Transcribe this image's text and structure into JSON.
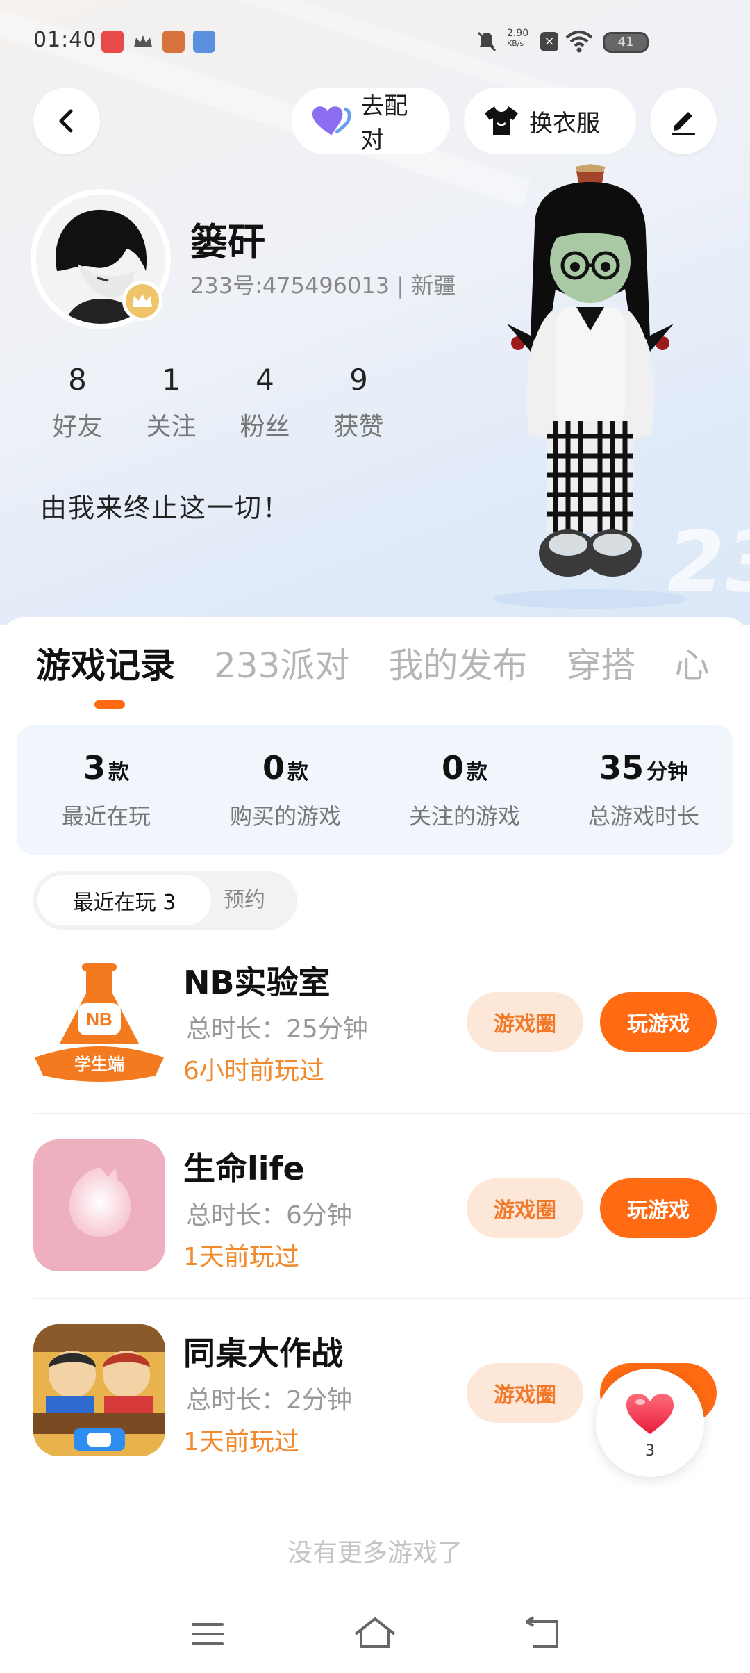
{
  "status_bar": {
    "time": "01:40",
    "net_speed": "2.90",
    "net_unit": "KB/s",
    "battery": "41"
  },
  "header": {
    "pair_label": "去配对",
    "dress_label": "换衣服"
  },
  "profile": {
    "nickname": "篓矸",
    "uid": "233号:475496013 | 新疆",
    "stats": [
      {
        "value": "8",
        "label": "好友"
      },
      {
        "value": "1",
        "label": "关注"
      },
      {
        "value": "4",
        "label": "粉丝"
      },
      {
        "value": "9",
        "label": "获赞"
      }
    ],
    "bio": "由我来终止这一切！"
  },
  "tabs": [
    "游戏记录",
    "233派对",
    "我的发布",
    "穿搭",
    "心"
  ],
  "summary": [
    {
      "value": "3",
      "unit": "款",
      "label": "最近在玩"
    },
    {
      "value": "0",
      "unit": "款",
      "label": "购买的游戏"
    },
    {
      "value": "0",
      "unit": "款",
      "label": "关注的游戏"
    },
    {
      "value": "35",
      "unit": "分钟",
      "label": "总游戏时长"
    }
  ],
  "segment": {
    "active": "最近在玩 3",
    "other": "预约"
  },
  "games": [
    {
      "name": "NB实验室",
      "icon": "flask-icon",
      "icon_text": "NB",
      "icon_banner": "学生端",
      "duration": "总时长：25分钟",
      "last_played": "6小时前玩过",
      "circle_label": "游戏圈",
      "play_label": "玩游戏"
    },
    {
      "name": "生命life",
      "icon": "heart-icon",
      "duration": "总时长：6分钟",
      "last_played": "1天前玩过",
      "circle_label": "游戏圈",
      "play_label": "玩游戏"
    },
    {
      "name": "同桌大作战",
      "icon": "desk-battle-icon",
      "duration": "总时长：2分钟",
      "last_played": "1天前玩过",
      "circle_label": "游戏圈",
      "play_label": "玩游戏"
    }
  ],
  "footer": {
    "no_more": "没有更多游戏了"
  },
  "like": {
    "count": "3"
  },
  "colors": {
    "accent": "#ff6a13",
    "accent_soft": "#fde7d9",
    "summary_bg": "#f1f5fc"
  }
}
